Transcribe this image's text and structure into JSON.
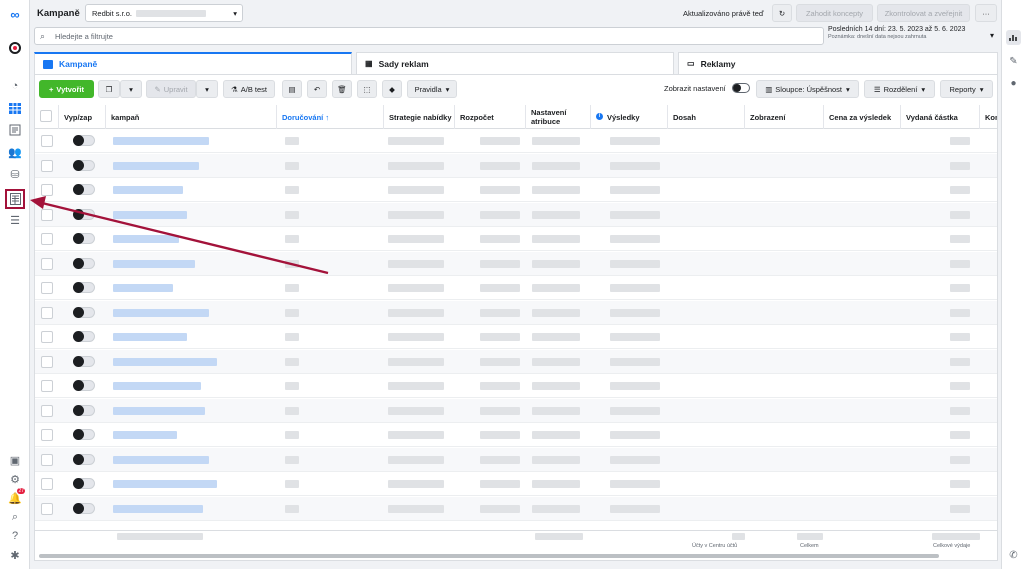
{
  "app": {
    "title": "Kampaně",
    "account": "Redbit s.r.o.",
    "updated": "Aktualizováno právě teď"
  },
  "topbar": {
    "discard": "Zahodit koncepty",
    "review": "Zkontrolovat a zveřejnit",
    "more": "···"
  },
  "search": {
    "placeholder": "Hledejte a filtrujte"
  },
  "date": {
    "range": "Posledních 14 dní: 23. 5. 2023 až 5. 6. 2023",
    "note": "Poznámka: dnešní data nejsou zahrnuta"
  },
  "tabs": [
    {
      "label": "Kampaně"
    },
    {
      "label": "Sady reklam"
    },
    {
      "label": "Reklamy"
    }
  ],
  "toolbar": {
    "create": "Vytvořit",
    "edit": "Upravit",
    "ab": "A/B test",
    "rules": "Pravidla",
    "show_settings": "Zobrazit nastavení",
    "columns": "Sloupce: Úspěšnost",
    "breakdown": "Rozdělení",
    "reports": "Reporty"
  },
  "columns": [
    "Vyp/zap",
    "kampaň",
    "Doručování ↑",
    "Strategie nabídky",
    "Rozpočet",
    "Nastavení atribuce",
    "Výsledky",
    "Dosah",
    "Zobrazení",
    "Cena za výsledek",
    "Vydaná částka",
    "Kon"
  ],
  "footer": {
    "results_note": "Účty v Centru účtů",
    "total": "Celkem",
    "spend_total": "Celkové výdaje"
  },
  "badges": {
    "notifications": "27"
  },
  "colors": {
    "accent": "#1877f2",
    "create": "#42b72a",
    "arrow": "#a3123a"
  }
}
